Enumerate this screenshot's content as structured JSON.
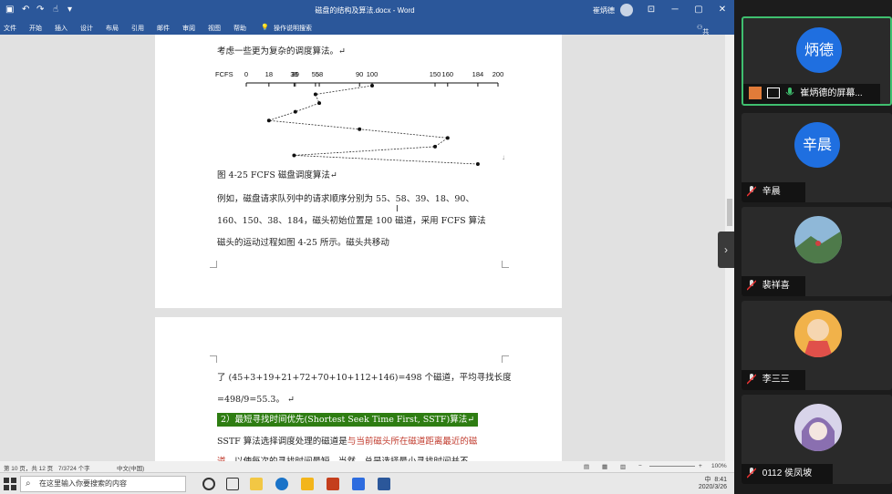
{
  "window": {
    "title": "磁盘的结构及算法.docx - Word",
    "user": "崔炳德",
    "search_hint": "操作说明搜索",
    "share": "共享"
  },
  "ribbon_tabs": [
    "文件",
    "开始",
    "插入",
    "设计",
    "布局",
    "引用",
    "邮件",
    "审阅",
    "视图",
    "帮助"
  ],
  "document": {
    "intro": "考虑一些更为复杂的调度算法。↵",
    "diagram_label": "FCFS",
    "axis_ticks": [
      "0",
      "18",
      "38",
      "39",
      "55",
      "58",
      "90",
      "100",
      "150",
      "160",
      "184",
      "200"
    ],
    "figure_caption": "图 4-25 FCFS 磁盘调度算法↵",
    "para1_line1": "例如，磁盘请求队列中的请求顺序分别为 55、58、39、18、90、",
    "para1_line2": "160、150、38、184，磁头初始位置是 100 磁道，采用 FCFS 算法",
    "para1_line3": "磁头的运动过程如图 4-25 所示。磁头共移动",
    "page2_line1": "了 (45+3+19+21+72+70+10+112+146)=498 个磁道，平均寻找长度",
    "page2_line2": "=498/9=55.3。  ↵",
    "heading": "2）最短寻找时间优先(Shortest  Seek  Time  First, SSTF)算法↵",
    "sstf_line1_a": "SSTF 算法选择调度处理的磁道是",
    "sstf_line1_b": "与当前磁头所在磁道距离最近的磁",
    "sstf_line2_a": "道",
    "sstf_line2_b": "，以使每次的寻找时间最短。当然，总是选择最小寻找时间并不"
  },
  "chart_data": {
    "type": "line",
    "title": "",
    "xlabel": "FCFS",
    "ylabel": "",
    "x_ticks": [
      0,
      18,
      38,
      39,
      55,
      58,
      90,
      100,
      150,
      160,
      184,
      200
    ],
    "xlim": [
      0,
      200
    ],
    "head_sequence": [
      100,
      55,
      58,
      39,
      18,
      90,
      160,
      150,
      38,
      184
    ]
  },
  "statusbar": {
    "page": "第 10 页，共 12 页",
    "words": "7/3724 个字",
    "lang": "中文(中国)",
    "zoom": "100%"
  },
  "taskbar": {
    "search_placeholder": "在这里输入你要搜索的内容",
    "time": "8:41",
    "date": "2020/3/26",
    "ime": "中"
  },
  "participants": [
    {
      "initials": "炳德",
      "name": "崔炳德的屏幕...",
      "color": "#1f6fe0"
    },
    {
      "initials": "辛晨",
      "name": "辛晨",
      "color": "#1f6fe0"
    },
    {
      "initials": "",
      "name": "裴祥喜",
      "color": "#5a8fb0"
    },
    {
      "initials": "",
      "name": "李三三",
      "color": "#f1b24a"
    },
    {
      "initials": "",
      "name": "0112 侯凤坡",
      "color": "#8a6fb0"
    }
  ]
}
